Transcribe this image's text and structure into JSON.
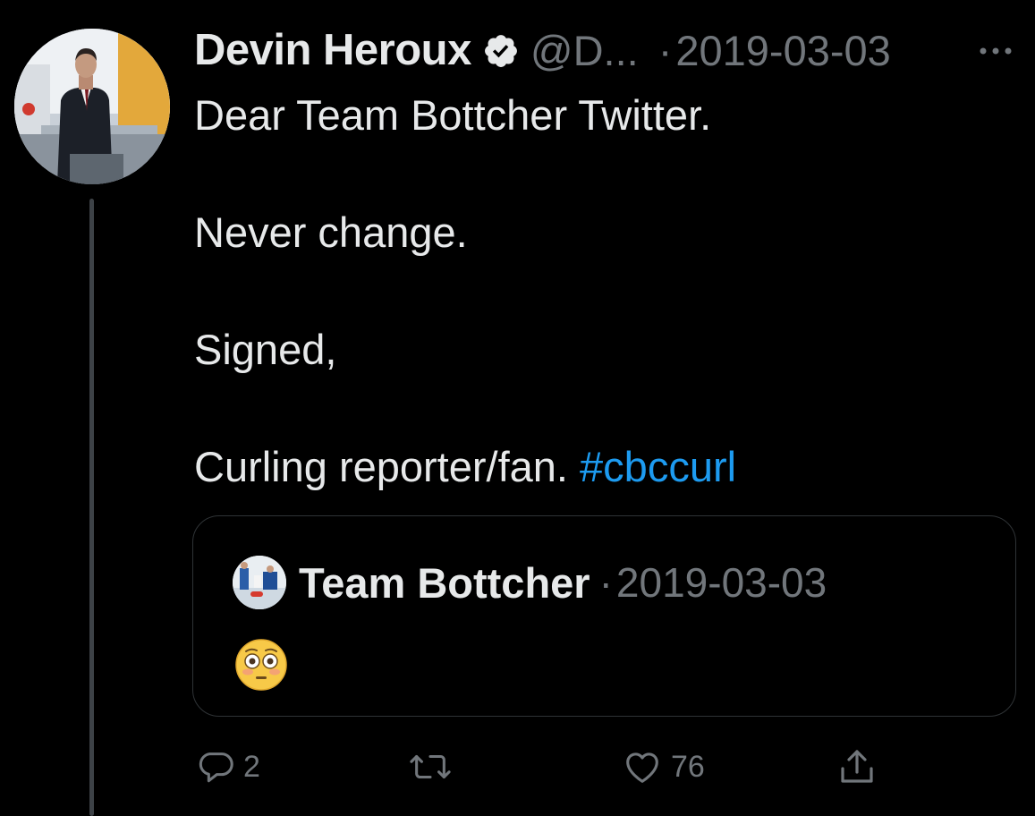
{
  "tweet": {
    "author_name": "Devin Heroux",
    "verified": true,
    "handle": "@D...",
    "separator": "·",
    "date": "2019-03-03",
    "body_lines": [
      "Dear Team Bottcher Twitter.",
      "",
      "Never change.",
      "",
      "Signed,",
      "",
      "Curling reporter/fan."
    ],
    "hashtag": "#cbccurl"
  },
  "quoted_tweet": {
    "author_name": "Team Bottcher",
    "separator": "·",
    "date": "2019-03-03",
    "emoji_icon": "flushed-face-icon"
  },
  "actions": {
    "reply_count": "2",
    "retweet_count": "",
    "like_count": "76"
  },
  "colors": {
    "background": "#000000",
    "text_primary": "#e7e9ea",
    "text_secondary": "#71767b",
    "link": "#1d9bf0",
    "border": "#2f3336"
  }
}
